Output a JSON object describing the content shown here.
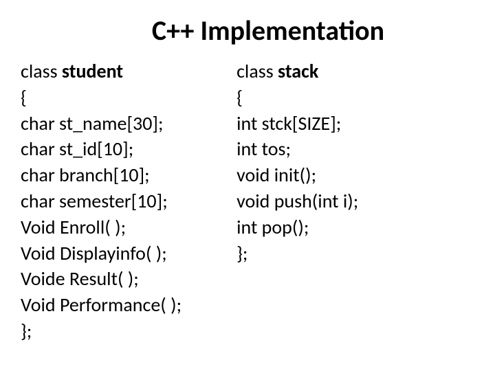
{
  "title": "C++ Implementation",
  "left": {
    "class_keyword": "class ",
    "class_name": "student",
    "lines": [
      "{",
      "char st_name[30];",
      "char st_id[10];",
      "char branch[10];",
      "char semester[10];",
      "Void Enroll( );",
      "Void Displayinfo( );",
      "Voide Result( );",
      "Void Performance( );",
      "};"
    ]
  },
  "right": {
    "class_keyword": "class ",
    "class_name": "stack",
    "lines": [
      " {",
      "int stck[SIZE];",
      "int tos;",
      "void init();",
      "void push(int i);",
      "int pop();",
      "};"
    ]
  }
}
